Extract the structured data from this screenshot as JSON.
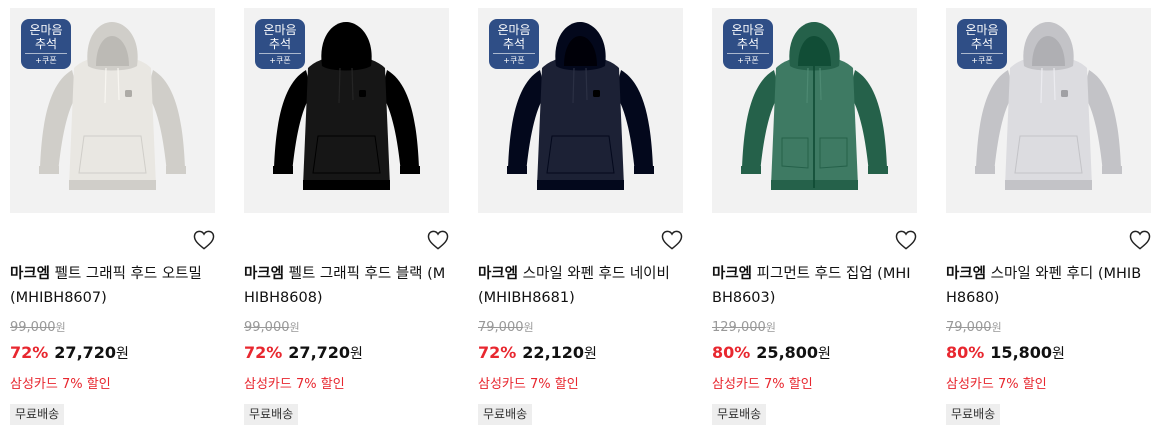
{
  "products": [
    {
      "badge": {
        "line1": "온마음",
        "line2": "추석",
        "line3": "+쿠폰"
      },
      "brand": "마크엠",
      "name": " 펠트 그래픽 후드 오트밀 (MHIBH8607)",
      "original_price": "99,000",
      "currency": "원",
      "discount": "72%",
      "sale_price": "27,720",
      "promo": "삼성카드 7% 할인",
      "shipping": "무료배송",
      "color": "#e9e7e2",
      "icon": "heart-icon"
    },
    {
      "badge": {
        "line1": "온마음",
        "line2": "추석",
        "line3": "+쿠폰"
      },
      "brand": "마크엠",
      "name": " 펠트 그래픽 후드 블랙 (MHIBH8608)",
      "original_price": "99,000",
      "currency": "원",
      "discount": "72%",
      "sale_price": "27,720",
      "promo": "삼성카드 7% 할인",
      "shipping": "무료배송",
      "color": "#161616",
      "icon": "heart-icon"
    },
    {
      "badge": {
        "line1": "온마음",
        "line2": "추석",
        "line3": "+쿠폰"
      },
      "brand": "마크엠",
      "name": " 스마일 와펜 후드 네이비 (MHIBH8681)",
      "original_price": "79,000",
      "currency": "원",
      "discount": "72%",
      "sale_price": "22,120",
      "promo": "삼성카드 7% 할인",
      "shipping": "무료배송",
      "color": "#1c2135",
      "icon": "heart-icon"
    },
    {
      "badge": {
        "line1": "온마음",
        "line2": "추석",
        "line3": "+쿠폰"
      },
      "brand": "마크엠",
      "name": " 피그먼트 후드 집업 (MHIBH8603)",
      "original_price": "129,000",
      "currency": "원",
      "discount": "80%",
      "sale_price": "25,800",
      "promo": "삼성카드 7% 할인",
      "shipping": "무료배송",
      "color": "#3e7a63",
      "icon": "heart-icon"
    },
    {
      "badge": {
        "line1": "온마음",
        "line2": "추석",
        "line3": "+쿠폰"
      },
      "brand": "마크엠",
      "name": " 스마일 와펜 후디 (MHIBH8680)",
      "original_price": "79,000",
      "currency": "원",
      "discount": "80%",
      "sale_price": "15,800",
      "promo": "삼성카드 7% 할인",
      "shipping": "무료배송",
      "color": "#dcdce0",
      "icon": "heart-icon"
    }
  ]
}
